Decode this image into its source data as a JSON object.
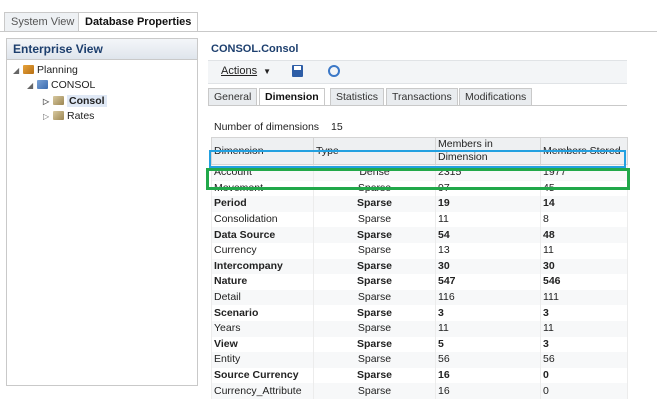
{
  "top_tabs": [
    "System View",
    "Database Properties"
  ],
  "left": {
    "title": "Enterprise View",
    "tree": [
      {
        "label": "Planning",
        "expanded": true
      },
      {
        "label": "CONSOL",
        "expanded": true
      },
      {
        "label": "Consol",
        "expanded": false,
        "selected": true
      },
      {
        "label": "Rates",
        "expanded": false
      }
    ]
  },
  "right": {
    "title": "CONSOL.Consol",
    "actions_label": "Actions",
    "tabs": [
      "General",
      "Dimension",
      "Statistics",
      "Transactions",
      "Modifications"
    ],
    "active_tab": "Dimension",
    "num_dims_label": "Number of dimensions",
    "num_dims_value": "15"
  },
  "table": {
    "headers": [
      "Dimension",
      "Type",
      "Members in Dimension",
      "Members Stored"
    ],
    "rows": [
      {
        "dim": "Account",
        "type": "Dense",
        "members": "2315",
        "stored": "1977",
        "bold": false
      },
      {
        "dim": "Movement",
        "type": "Sparse",
        "members": "97",
        "stored": "45",
        "bold": false
      },
      {
        "dim": "Period",
        "type": "Sparse",
        "members": "19",
        "stored": "14",
        "bold": true
      },
      {
        "dim": "Consolidation",
        "type": "Sparse",
        "members": "11",
        "stored": "8",
        "bold": false
      },
      {
        "dim": "Data Source",
        "type": "Sparse",
        "members": "54",
        "stored": "48",
        "bold": true
      },
      {
        "dim": "Currency",
        "type": "Sparse",
        "members": "13",
        "stored": "11",
        "bold": false
      },
      {
        "dim": "Intercompany",
        "type": "Sparse",
        "members": "30",
        "stored": "30",
        "bold": true
      },
      {
        "dim": "Nature",
        "type": "Sparse",
        "members": "547",
        "stored": "546",
        "bold": true
      },
      {
        "dim": "Detail",
        "type": "Sparse",
        "members": "116",
        "stored": "111",
        "bold": false
      },
      {
        "dim": "Scenario",
        "type": "Sparse",
        "members": "3",
        "stored": "3",
        "bold": true
      },
      {
        "dim": "Years",
        "type": "Sparse",
        "members": "11",
        "stored": "11",
        "bold": false
      },
      {
        "dim": "View",
        "type": "Sparse",
        "members": "5",
        "stored": "3",
        "bold": true
      },
      {
        "dim": "Entity",
        "type": "Sparse",
        "members": "56",
        "stored": "56",
        "bold": false
      },
      {
        "dim": "Source Currency",
        "type": "Sparse",
        "members": "16",
        "stored": "0",
        "bold": true
      },
      {
        "dim": "Currency_Attribute",
        "type": "Sparse",
        "members": "16",
        "stored": "0",
        "bold": false
      }
    ]
  },
  "colors": {
    "highlight_blue": "#22a0e0",
    "highlight_green": "#21a84a",
    "title_blue": "#1d3f6e"
  }
}
